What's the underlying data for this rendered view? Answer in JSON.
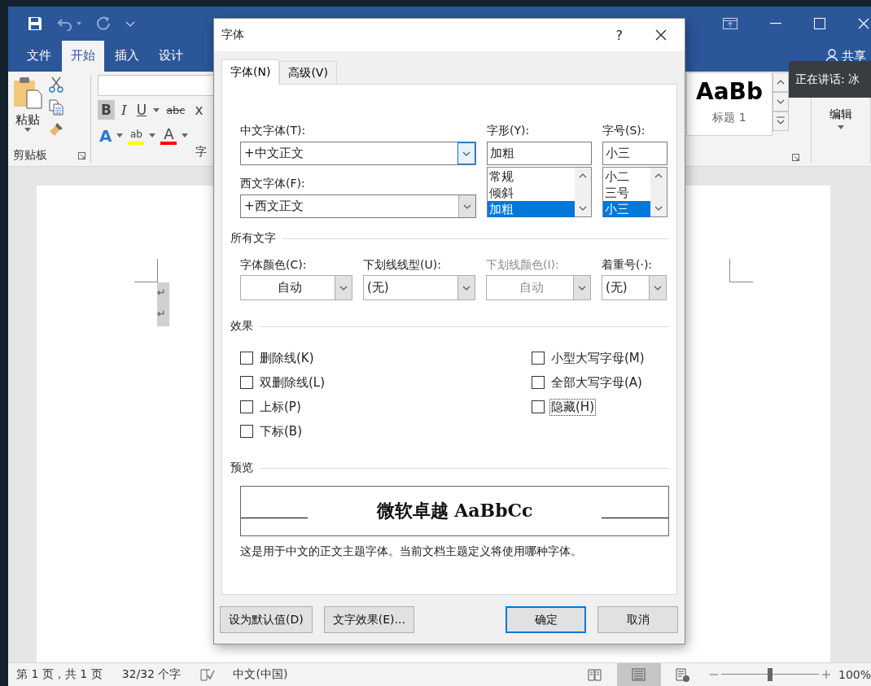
{
  "ribbon": {
    "tabs": [
      {
        "label": "文件",
        "selected": false
      },
      {
        "label": "开始",
        "selected": true
      },
      {
        "label": "插入",
        "selected": false
      },
      {
        "label": "设计",
        "selected": false
      }
    ],
    "share": "共享",
    "clipboard": {
      "paste": "粘贴",
      "group": "剪贴板"
    },
    "font_group": {
      "buttons": [
        {
          "label": "B",
          "kind": "bold",
          "selected": true
        },
        {
          "label": "I",
          "kind": "italic",
          "selected": false
        },
        {
          "label": "U",
          "kind": "underline",
          "selected": false
        },
        {
          "label": "abc",
          "kind": "strike",
          "selected": false
        },
        {
          "label": "x",
          "kind": "subscript",
          "selected": false
        }
      ],
      "color_buttons": [
        {
          "label": "A",
          "kind": "effects"
        },
        {
          "label": "ab",
          "kind": "highlight",
          "color": "#ffff00"
        },
        {
          "label": "A",
          "kind": "font-color",
          "color": "#ff0000"
        }
      ],
      "group": "字"
    },
    "styles": {
      "sample": "AaBb",
      "name": "标题 1"
    },
    "editing": {
      "label": "编辑"
    }
  },
  "tooltip": "正在讲话: 冰",
  "document": {
    "paragraph_marks": [
      "↵",
      "↵"
    ]
  },
  "status_bar": {
    "page": "第 1 页，共 1 页",
    "words": "32/32 个字",
    "language": "中文(中国)",
    "views": [
      {
        "kind": "read",
        "selected": false
      },
      {
        "kind": "print",
        "selected": true
      },
      {
        "kind": "web",
        "selected": false
      }
    ],
    "zoom_slider": {
      "level": 0.5
    },
    "zoom": "100%"
  },
  "dialog": {
    "title": "字体",
    "help": "?",
    "tabs": [
      {
        "label": "字体(N)",
        "selected": true
      },
      {
        "label": "高级(V)",
        "selected": false
      }
    ],
    "chinese_font": {
      "label": "中文字体(T):",
      "value": "+中文正文",
      "focused": true
    },
    "western_font": {
      "label": "西文字体(F):",
      "value": "+西文正文",
      "focused": false
    },
    "style": {
      "label": "字形(Y):",
      "value": "加粗",
      "options": [
        {
          "label": "常规",
          "selected": false
        },
        {
          "label": "倾斜",
          "selected": false
        },
        {
          "label": "加粗",
          "selected": true
        }
      ]
    },
    "size": {
      "label": "字号(S):",
      "value": "小三",
      "options": [
        {
          "label": "小二",
          "selected": false
        },
        {
          "label": "三号",
          "selected": false
        },
        {
          "label": "小三",
          "selected": true
        }
      ]
    },
    "all_text": {
      "heading": "所有文字",
      "dropdowns": [
        {
          "label": "字体颜色(C):",
          "value": "自动",
          "kind": "color",
          "disabled": false
        },
        {
          "label": "下划线线型(U):",
          "value": "(无)",
          "kind": "list",
          "disabled": false
        },
        {
          "label": "下划线颜色(I):",
          "value": "自动",
          "kind": "color",
          "disabled": true
        },
        {
          "label": "着重号(·):",
          "value": "(无)",
          "kind": "list",
          "disabled": false
        }
      ]
    },
    "effects": {
      "heading": "效果",
      "columns": [
        [
          {
            "label": "删除线(K)",
            "checked": false,
            "focused": false
          },
          {
            "label": "双删除线(L)",
            "checked": false,
            "focused": false
          },
          {
            "label": "上标(P)",
            "checked": false,
            "focused": false
          },
          {
            "label": "下标(B)",
            "checked": false,
            "focused": false
          }
        ],
        [
          {
            "label": "小型大写字母(M)",
            "checked": false,
            "focused": false
          },
          {
            "label": "全部大写字母(A)",
            "checked": false,
            "focused": false
          },
          {
            "label": "隐藏(H)",
            "checked": false,
            "focused": true
          }
        ]
      ]
    },
    "preview": {
      "heading": "预览",
      "sample": "微软卓越  AaBbCc",
      "note": "这是用于中文的正文主题字体。当前文档主题定义将使用哪种字体。"
    },
    "left_buttons": [
      {
        "label": "设为默认值(D)",
        "default": false
      },
      {
        "label": "文字效果(E)...",
        "default": false
      }
    ],
    "right_buttons": [
      {
        "label": "确定",
        "default": true
      },
      {
        "label": "取消",
        "default": false
      }
    ]
  }
}
